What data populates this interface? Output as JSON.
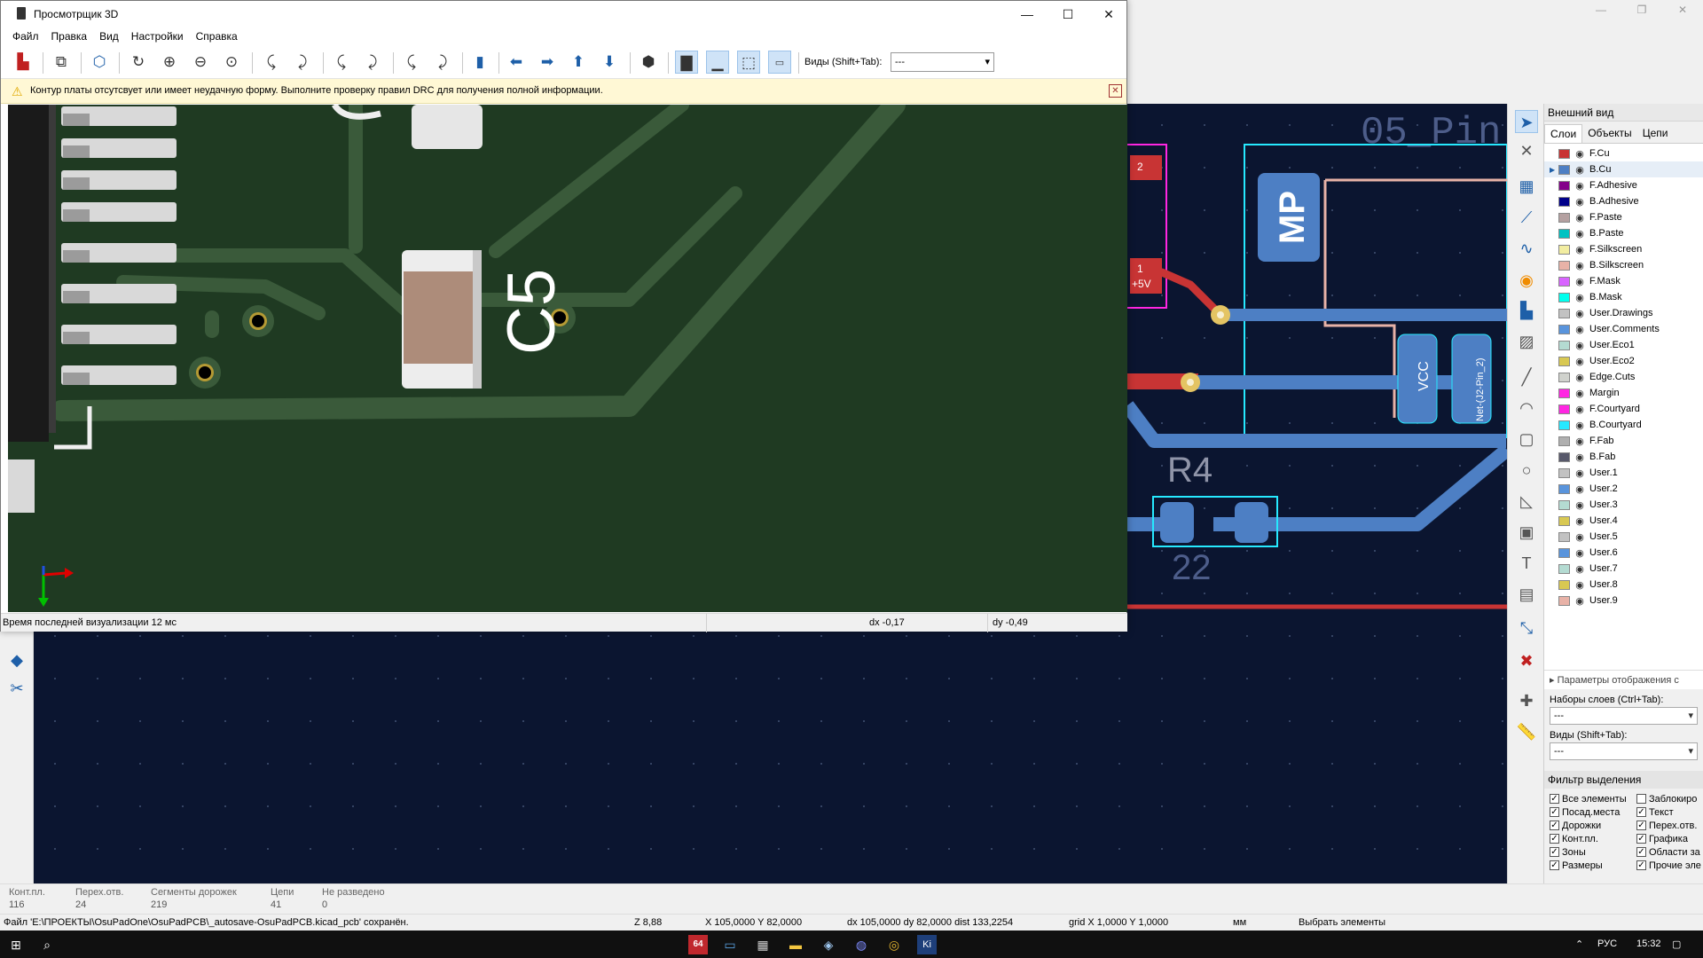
{
  "viewer": {
    "title": "Просмотрщик 3D",
    "menu": [
      "Файл",
      "Правка",
      "Вид",
      "Настройки",
      "Справка"
    ],
    "views_label": "Виды (Shift+Tab):",
    "views_value": "---",
    "warning": "Контур платы отсутсвует или имеет неудачную форму. Выполните проверку правил DRC для получения полной информации.",
    "status_render": "Время последней визуализации 12 мс",
    "status_dx": "dx -0,17",
    "status_dy": "dy -0,49",
    "component_label": "C5"
  },
  "pcb": {
    "silk_title": "05_Pin",
    "pad_labels": {
      "mp": "MP",
      "vcc": "VCC",
      "net": "Net-(J2-Pin_2)",
      "r4": "R4",
      "r4_value": "22",
      "plus5v": "+5V",
      "p1": "1",
      "p2": "2"
    }
  },
  "appearance": {
    "header": "Внешний вид",
    "tabs": [
      "Слои",
      "Объекты",
      "Цепи"
    ],
    "layers": [
      {
        "name": "F.Cu",
        "color": "#c83434"
      },
      {
        "name": "B.Cu",
        "color": "#4d7fc4"
      },
      {
        "name": "F.Adhesive",
        "color": "#84008a"
      },
      {
        "name": "B.Adhesive",
        "color": "#00008a"
      },
      {
        "name": "F.Paste",
        "color": "#b4a0a0"
      },
      {
        "name": "B.Paste",
        "color": "#00c2c2"
      },
      {
        "name": "F.Silkscreen",
        "color": "#f2eda1"
      },
      {
        "name": "B.Silkscreen",
        "color": "#e8b2a7"
      },
      {
        "name": "F.Mask",
        "color": "#d864ff"
      },
      {
        "name": "B.Mask",
        "color": "#02ffee"
      },
      {
        "name": "User.Drawings",
        "color": "#c2c2c2"
      },
      {
        "name": "User.Comments",
        "color": "#5994dc"
      },
      {
        "name": "User.Eco1",
        "color": "#b4dbd2"
      },
      {
        "name": "User.Eco2",
        "color": "#d8c852"
      },
      {
        "name": "Edge.Cuts",
        "color": "#d0d2cd"
      },
      {
        "name": "Margin",
        "color": "#ff26e2"
      },
      {
        "name": "F.Courtyard",
        "color": "#ff26e2"
      },
      {
        "name": "B.Courtyard",
        "color": "#26e9ff"
      },
      {
        "name": "F.Fab",
        "color": "#afafaf"
      },
      {
        "name": "B.Fab",
        "color": "#58596b"
      },
      {
        "name": "User.1",
        "color": "#c2c2c2"
      },
      {
        "name": "User.2",
        "color": "#5994dc"
      },
      {
        "name": "User.3",
        "color": "#b4dbd2"
      },
      {
        "name": "User.4",
        "color": "#d8c852"
      },
      {
        "name": "User.5",
        "color": "#c2c2c2"
      },
      {
        "name": "User.6",
        "color": "#5994dc"
      },
      {
        "name": "User.7",
        "color": "#b4dbd2"
      },
      {
        "name": "User.8",
        "color": "#d8c852"
      },
      {
        "name": "User.9",
        "color": "#e8b2a7"
      }
    ],
    "display_options": "Параметры отображения с",
    "layer_sets_label": "Наборы слоев (Ctrl+Tab):",
    "layer_sets_value": "---",
    "views_label": "Виды (Shift+Tab):",
    "views_value": "---",
    "filter_header": "Фильтр выделения",
    "filter_items": [
      "Все элементы",
      "Заблокиро",
      "Посад.места",
      "Текст",
      "Дорожки",
      "Перех.отв.",
      "Конт.пл.",
      "Графика",
      "Зоны",
      "Области за",
      "Размеры",
      "Прочие эле"
    ]
  },
  "info": {
    "cols": [
      {
        "label": "Конт.пл.",
        "value": "116"
      },
      {
        "label": "Перех.отв.",
        "value": "24"
      },
      {
        "label": "Сегменты дорожек",
        "value": "219"
      },
      {
        "label": "Цепи",
        "value": "41"
      },
      {
        "label": "Не разведено",
        "value": "0"
      }
    ]
  },
  "status": {
    "file": "Файл 'E:\\ПРОЕКТЫ\\OsuPadOne\\OsuPadPCB\\_autosave-OsuPadPCB.kicad_pcb' сохранён.",
    "zoom": "Z 8,88",
    "xy": "X 105,0000  Y 82,0000",
    "dxdy": "dx 105,0000  dy 82,0000  dist 133,2254",
    "grid": "grid X 1,0000  Y 1,0000",
    "units": "мм",
    "mode": "Выбрать элементы"
  },
  "taskbar": {
    "lang": "РУС",
    "time": "15:32",
    "badge": "64"
  }
}
